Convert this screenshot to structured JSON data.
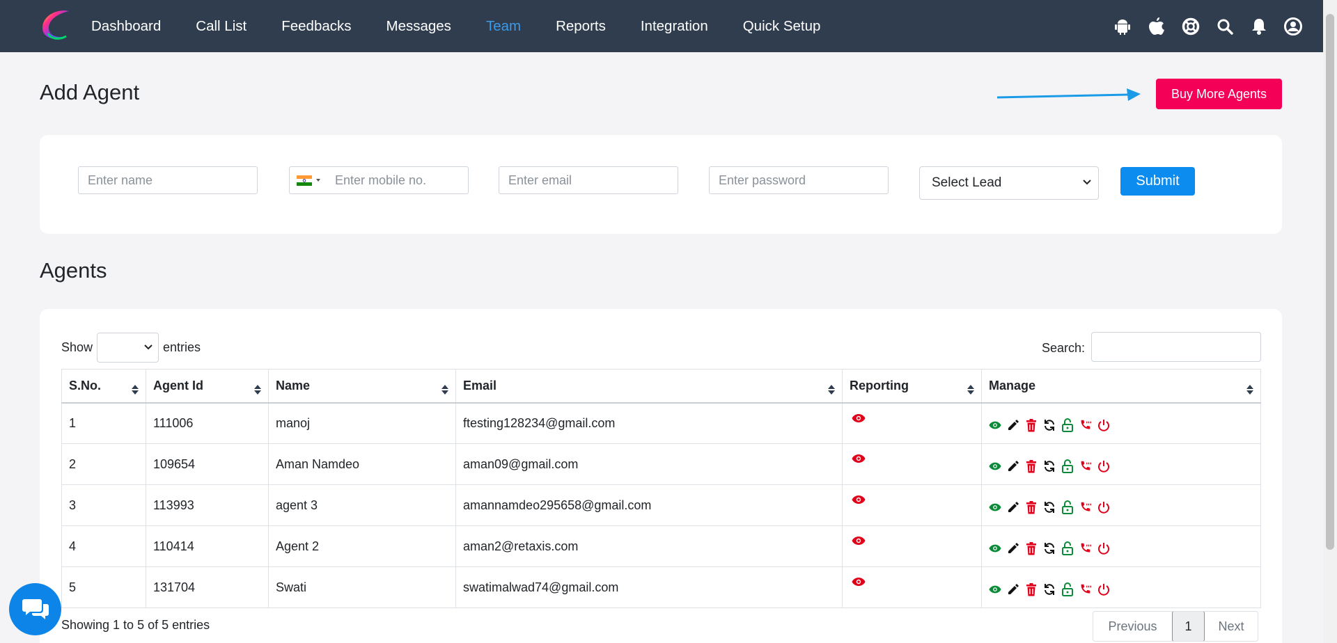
{
  "nav": {
    "items": [
      {
        "label": "Dashboard",
        "active": false
      },
      {
        "label": "Call List",
        "active": false
      },
      {
        "label": "Feedbacks",
        "active": false
      },
      {
        "label": "Messages",
        "active": false
      },
      {
        "label": "Team",
        "active": true
      },
      {
        "label": "Reports",
        "active": false
      },
      {
        "label": "Integration",
        "active": false
      },
      {
        "label": "Quick Setup",
        "active": false
      }
    ],
    "icons": [
      "android-icon",
      "apple-icon",
      "support-icon",
      "search-icon",
      "bell-icon",
      "user-icon"
    ],
    "active_color": "#3d9ae8",
    "bg_color": "#2f3d4e"
  },
  "add_agent": {
    "title": "Add Agent",
    "buy_button": "Buy More Agents",
    "buy_color": "#f50057",
    "name_placeholder": "Enter name",
    "mobile_placeholder": "Enter mobile no.",
    "email_placeholder": "Enter email",
    "password_placeholder": "Enter password",
    "lead_select": "Select Lead",
    "submit": "Submit",
    "submit_color": "#0d8cf0"
  },
  "agents": {
    "title": "Agents",
    "show_label": "Show",
    "entries_label": "entries",
    "search_label": "Search:",
    "columns": [
      "S.No.",
      "Agent Id",
      "Name",
      "Email",
      "Reporting",
      "Manage"
    ],
    "rows": [
      {
        "sno": "1",
        "id": "111006",
        "name": "manoj",
        "email": "ftesting128234@gmail.com"
      },
      {
        "sno": "2",
        "id": "109654",
        "name": "Aman Namdeo",
        "email": "aman09@gmail.com"
      },
      {
        "sno": "3",
        "id": "113993",
        "name": "agent 3",
        "email": "amannamdeo295658@gmail.com"
      },
      {
        "sno": "4",
        "id": "110414",
        "name": "Agent 2",
        "email": "aman2@retaxis.com"
      },
      {
        "sno": "5",
        "id": "131704",
        "name": "Swati",
        "email": "swatimalwad74@gmail.com"
      }
    ],
    "manage_icons": [
      "view-icon",
      "edit-icon",
      "delete-icon",
      "refresh-icon",
      "lock-icon",
      "call-icon",
      "power-icon"
    ],
    "info": "Showing 1 to 5 of 5 entries",
    "pagination": {
      "previous": "Previous",
      "page": "1",
      "next": "Next"
    }
  },
  "chat": {
    "icon": "chat-icon"
  }
}
